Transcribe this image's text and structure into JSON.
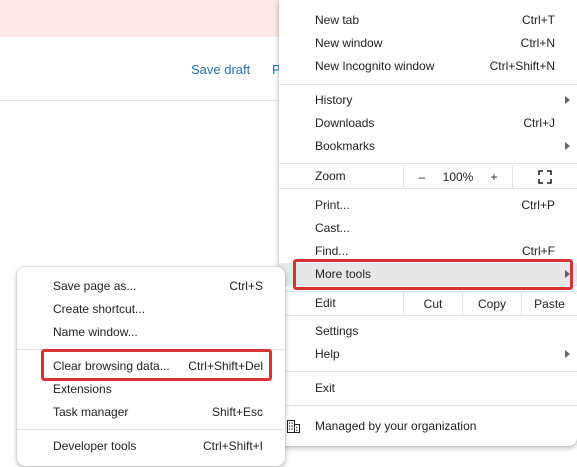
{
  "page": {
    "save_draft": "Save draft",
    "publish_partial": "P"
  },
  "main_menu": {
    "new_tab": {
      "label": "New tab",
      "shortcut": "Ctrl+T"
    },
    "new_window": {
      "label": "New window",
      "shortcut": "Ctrl+N"
    },
    "new_incognito": {
      "label": "New Incognito window",
      "shortcut": "Ctrl+Shift+N"
    },
    "history": {
      "label": "History"
    },
    "downloads": {
      "label": "Downloads",
      "shortcut": "Ctrl+J"
    },
    "bookmarks": {
      "label": "Bookmarks"
    },
    "zoom": {
      "label": "Zoom",
      "minus": "–",
      "value": "100%",
      "plus": "+"
    },
    "print": {
      "label": "Print...",
      "shortcut": "Ctrl+P"
    },
    "cast": {
      "label": "Cast..."
    },
    "find": {
      "label": "Find...",
      "shortcut": "Ctrl+F"
    },
    "more_tools": {
      "label": "More tools"
    },
    "edit": {
      "label": "Edit",
      "cut": "Cut",
      "copy": "Copy",
      "paste": "Paste"
    },
    "settings": {
      "label": "Settings"
    },
    "help": {
      "label": "Help"
    },
    "exit": {
      "label": "Exit"
    },
    "managed": {
      "label": "Managed by your organization"
    }
  },
  "sub_menu": {
    "save_page": {
      "label": "Save page as...",
      "shortcut": "Ctrl+S"
    },
    "create_shortcut": {
      "label": "Create shortcut..."
    },
    "name_window": {
      "label": "Name window..."
    },
    "clear_browsing": {
      "label": "Clear browsing data...",
      "shortcut": "Ctrl+Shift+Del"
    },
    "extensions": {
      "label": "Extensions"
    },
    "task_manager": {
      "label": "Task manager",
      "shortcut": "Shift+Esc"
    },
    "developer_tools": {
      "label": "Developer tools",
      "shortcut": "Ctrl+Shift+I"
    }
  },
  "colors": {
    "highlight": "#d93434",
    "link": "#2271b1",
    "hover": "#e8e8e8"
  }
}
